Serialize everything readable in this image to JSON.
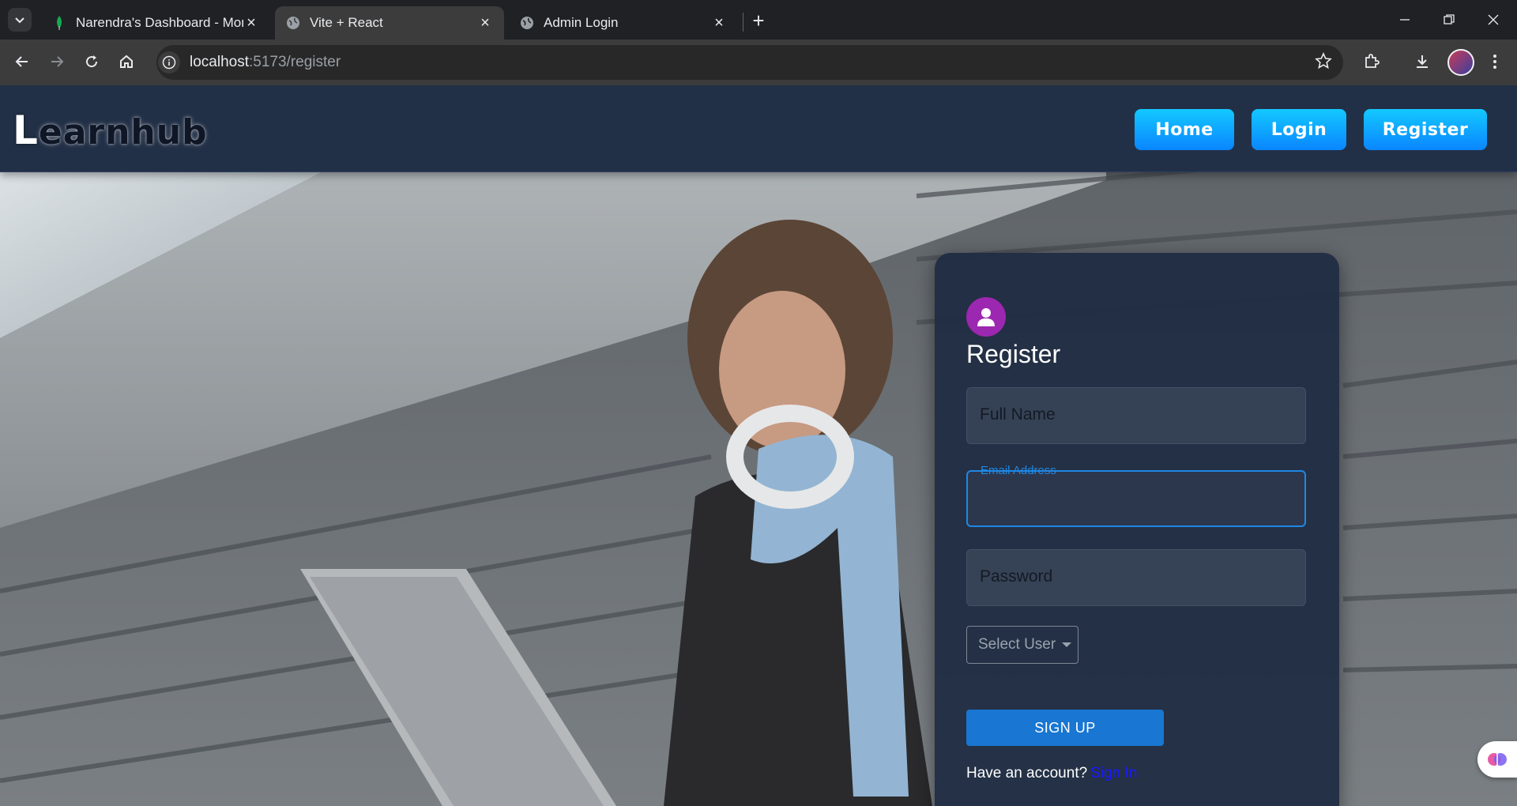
{
  "browser": {
    "tabs": [
      {
        "title": "Narendra's Dashboard - Mongo",
        "active": false
      },
      {
        "title": "Vite + React",
        "active": true
      },
      {
        "title": "Admin Login",
        "active": false
      }
    ],
    "url_host": "localhost",
    "url_rest": ":5173/register"
  },
  "site": {
    "logo_first": "L",
    "logo_rest": "earnhub",
    "nav": [
      {
        "label": "Home"
      },
      {
        "label": "Login"
      },
      {
        "label": "Register"
      }
    ]
  },
  "form": {
    "heading": "Register",
    "full_name_placeholder": "Full Name",
    "email_label": "Email Address",
    "email_value": "",
    "password_placeholder": "Password",
    "select_user": "Select User",
    "submit_label": "SIGN UP",
    "have_account": "Have an account?",
    "sign_in_link": "Sign In"
  },
  "colors": {
    "nav_button": "#0a9cff",
    "submit": "#1976d2",
    "avatar_badge": "#9c27b0",
    "focus": "#1e88e5",
    "link": "#1a1aff"
  }
}
